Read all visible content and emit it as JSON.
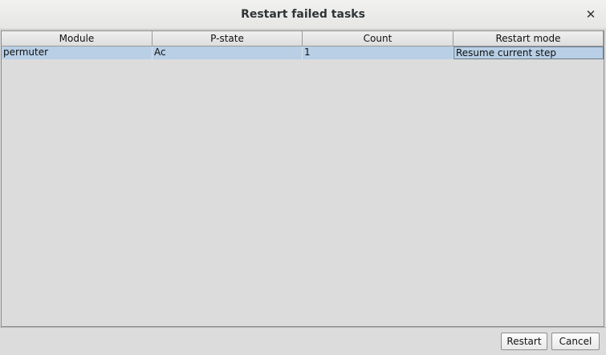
{
  "window": {
    "title": "Restart failed tasks",
    "close_glyph": "✕"
  },
  "table": {
    "columns": [
      "Module",
      "P-state",
      "Count",
      "Restart mode"
    ],
    "rows": [
      {
        "module": "permuter",
        "p_state": "Ac",
        "count": "1",
        "restart_mode": "Resume current step"
      }
    ],
    "selected_row_color": "#b8cfe5"
  },
  "buttons": {
    "restart_label": "Restart",
    "cancel_label": "Cancel"
  }
}
